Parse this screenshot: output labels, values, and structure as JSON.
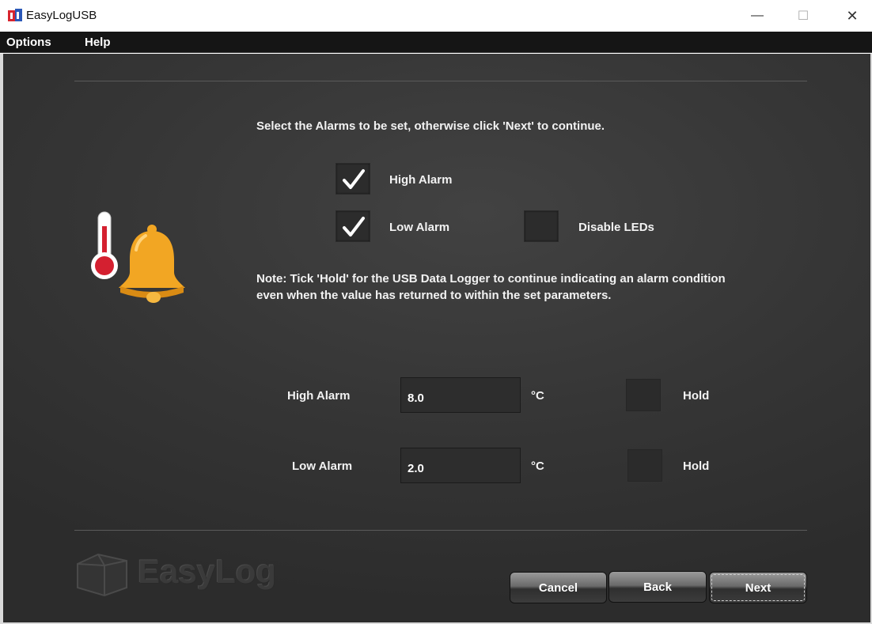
{
  "window": {
    "title": "EasyLogUSB",
    "minimize_glyph": "—",
    "maximize_glyph": "☐",
    "close_glyph": "✕"
  },
  "menu": {
    "options": "Options",
    "help": "Help"
  },
  "instruction": "Select the Alarms to be set, otherwise click 'Next' to continue.",
  "alarms": {
    "high": {
      "label": "High Alarm",
      "checked": true
    },
    "low": {
      "label": "Low Alarm",
      "checked": true
    },
    "disable_leds": {
      "label": "Disable LEDs",
      "checked": false
    }
  },
  "note": "Note: Tick 'Hold' for the USB Data Logger to continue indicating an alarm condition even when the value has returned to within the set parameters.",
  "levels": {
    "high": {
      "label": "High Alarm",
      "value": "8.0",
      "unit": "°C",
      "hold_label": "Hold",
      "hold": false
    },
    "low": {
      "label": "Low Alarm",
      "value": "2.0",
      "unit": "°C",
      "hold_label": "Hold",
      "hold": false
    }
  },
  "logo_text": "EasyLog",
  "buttons": {
    "cancel": "Cancel",
    "back": "Back",
    "next": "Next"
  },
  "colors": {
    "background": "#353535",
    "menubar": "#151515",
    "bell": "#f2a623",
    "thermometer_bulb": "#d42030"
  }
}
